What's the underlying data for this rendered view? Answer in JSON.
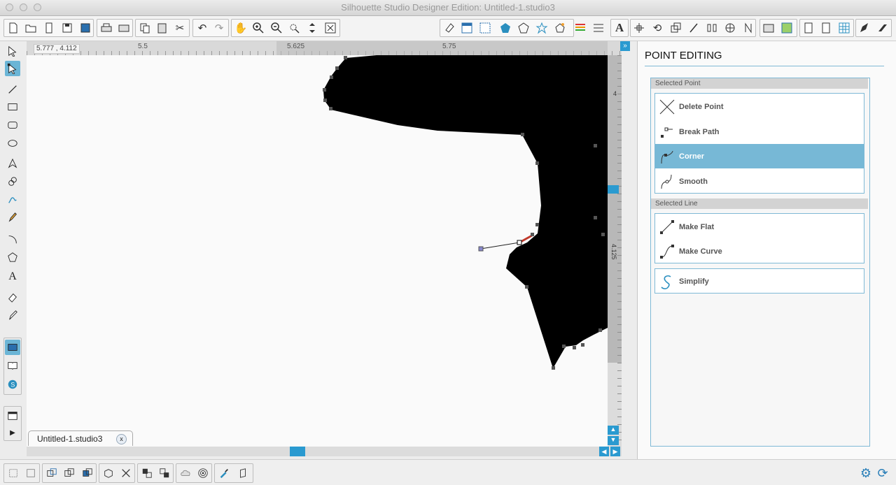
{
  "window": {
    "title": "Silhouette Studio Designer Edition: Untitled-1.studio3"
  },
  "canvas": {
    "coordinate_readout": "5.777 , 4.112",
    "ruler_top_labels": [
      "5.5",
      "5.625",
      "5.75"
    ],
    "ruler_right_labels": [
      "4",
      "4.125"
    ],
    "document_tab": "Untitled-1.studio3"
  },
  "panel": {
    "title": "POINT EDITING",
    "selected_point_header": "Selected Point",
    "selected_point_options": [
      {
        "label": "Delete Point",
        "icon": "x-curve-icon"
      },
      {
        "label": "Break Path",
        "icon": "break-path-icon"
      },
      {
        "label": "Corner",
        "icon": "corner-icon"
      },
      {
        "label": "Smooth",
        "icon": "smooth-icon"
      }
    ],
    "selected_option": "Corner",
    "selected_line_header": "Selected Line",
    "selected_line_options": [
      {
        "label": "Make Flat",
        "icon": "make-flat-icon"
      },
      {
        "label": "Make Curve",
        "icon": "make-curve-icon"
      }
    ],
    "simplify_label": "Simplify"
  },
  "colors": {
    "accent": "#77b8d6",
    "shape_fill": "#000000",
    "panel_border": "#7fb9d6"
  }
}
